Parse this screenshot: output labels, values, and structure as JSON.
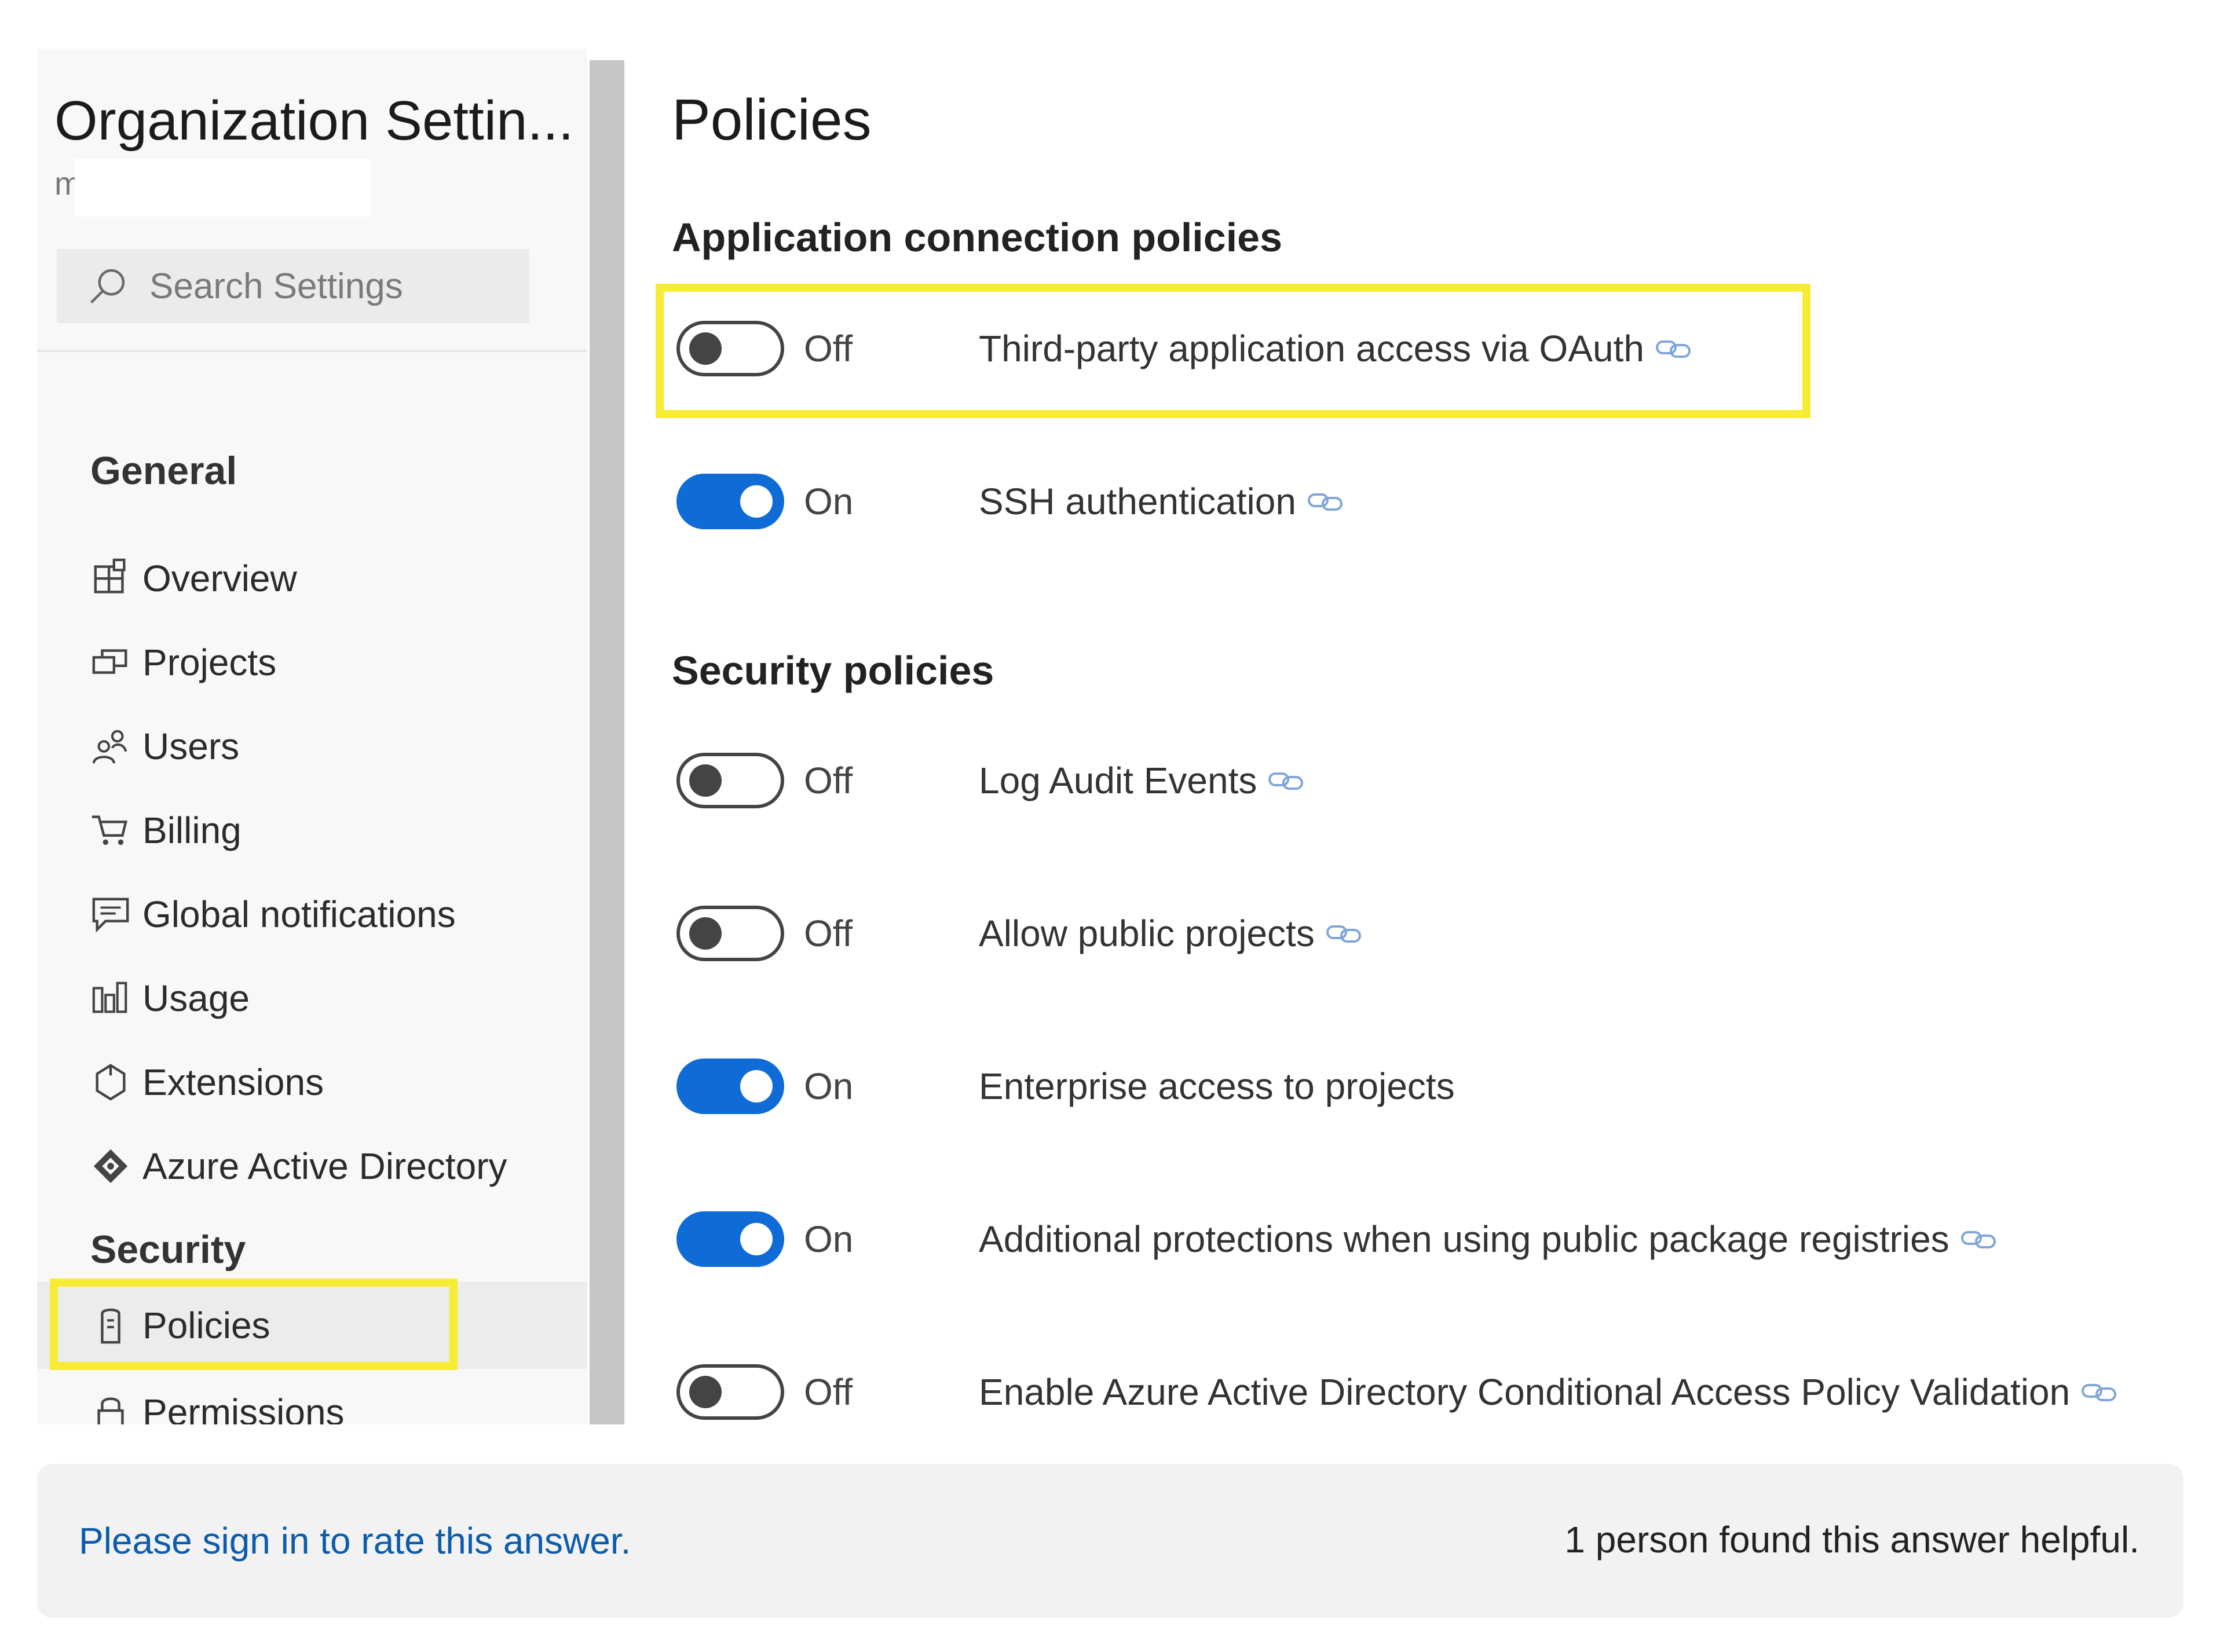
{
  "sidebar": {
    "org_title": "Organization Settin...",
    "org_subtitle": "m",
    "search_placeholder": "Search Settings",
    "sections": [
      {
        "header": "General",
        "items": [
          {
            "label": "Overview",
            "icon": "overview-icon"
          },
          {
            "label": "Projects",
            "icon": "projects-icon"
          },
          {
            "label": "Users",
            "icon": "users-icon"
          },
          {
            "label": "Billing",
            "icon": "cart-icon"
          },
          {
            "label": "Global notifications",
            "icon": "notification-icon"
          },
          {
            "label": "Usage",
            "icon": "usage-icon"
          },
          {
            "label": "Extensions",
            "icon": "extensions-icon"
          },
          {
            "label": "Azure Active Directory",
            "icon": "azure-ad-icon"
          }
        ]
      },
      {
        "header": "Security",
        "items": [
          {
            "label": "Policies",
            "icon": "policies-icon",
            "selected": true
          },
          {
            "label": "Permissions",
            "icon": "lock-icon"
          }
        ]
      }
    ]
  },
  "main": {
    "title": "Policies",
    "sections": [
      {
        "title": "Application connection policies",
        "policies": [
          {
            "state": "Off",
            "enabled": false,
            "label": "Third-party application access via OAuth",
            "has_link": true
          },
          {
            "state": "On",
            "enabled": true,
            "label": "SSH authentication",
            "has_link": true
          }
        ]
      },
      {
        "title": "Security policies",
        "policies": [
          {
            "state": "Off",
            "enabled": false,
            "label": "Log Audit Events",
            "has_link": true
          },
          {
            "state": "Off",
            "enabled": false,
            "label": "Allow public projects",
            "has_link": true
          },
          {
            "state": "On",
            "enabled": true,
            "label": "Enterprise access to projects",
            "has_link": false
          },
          {
            "state": "On",
            "enabled": true,
            "label": "Additional protections when using public package registries",
            "has_link": true
          },
          {
            "state": "Off",
            "enabled": false,
            "label": "Enable Azure Active Directory Conditional Access Policy Validation",
            "has_link": true
          }
        ]
      }
    ]
  },
  "footer": {
    "sign_in_link": "Please sign in to rate this answer.",
    "helpful_text": "1 person found this answer helpful."
  },
  "colors": {
    "toggle_on": "#0f6cd6",
    "highlight": "#f7ec34",
    "link": "#0b5cad"
  }
}
